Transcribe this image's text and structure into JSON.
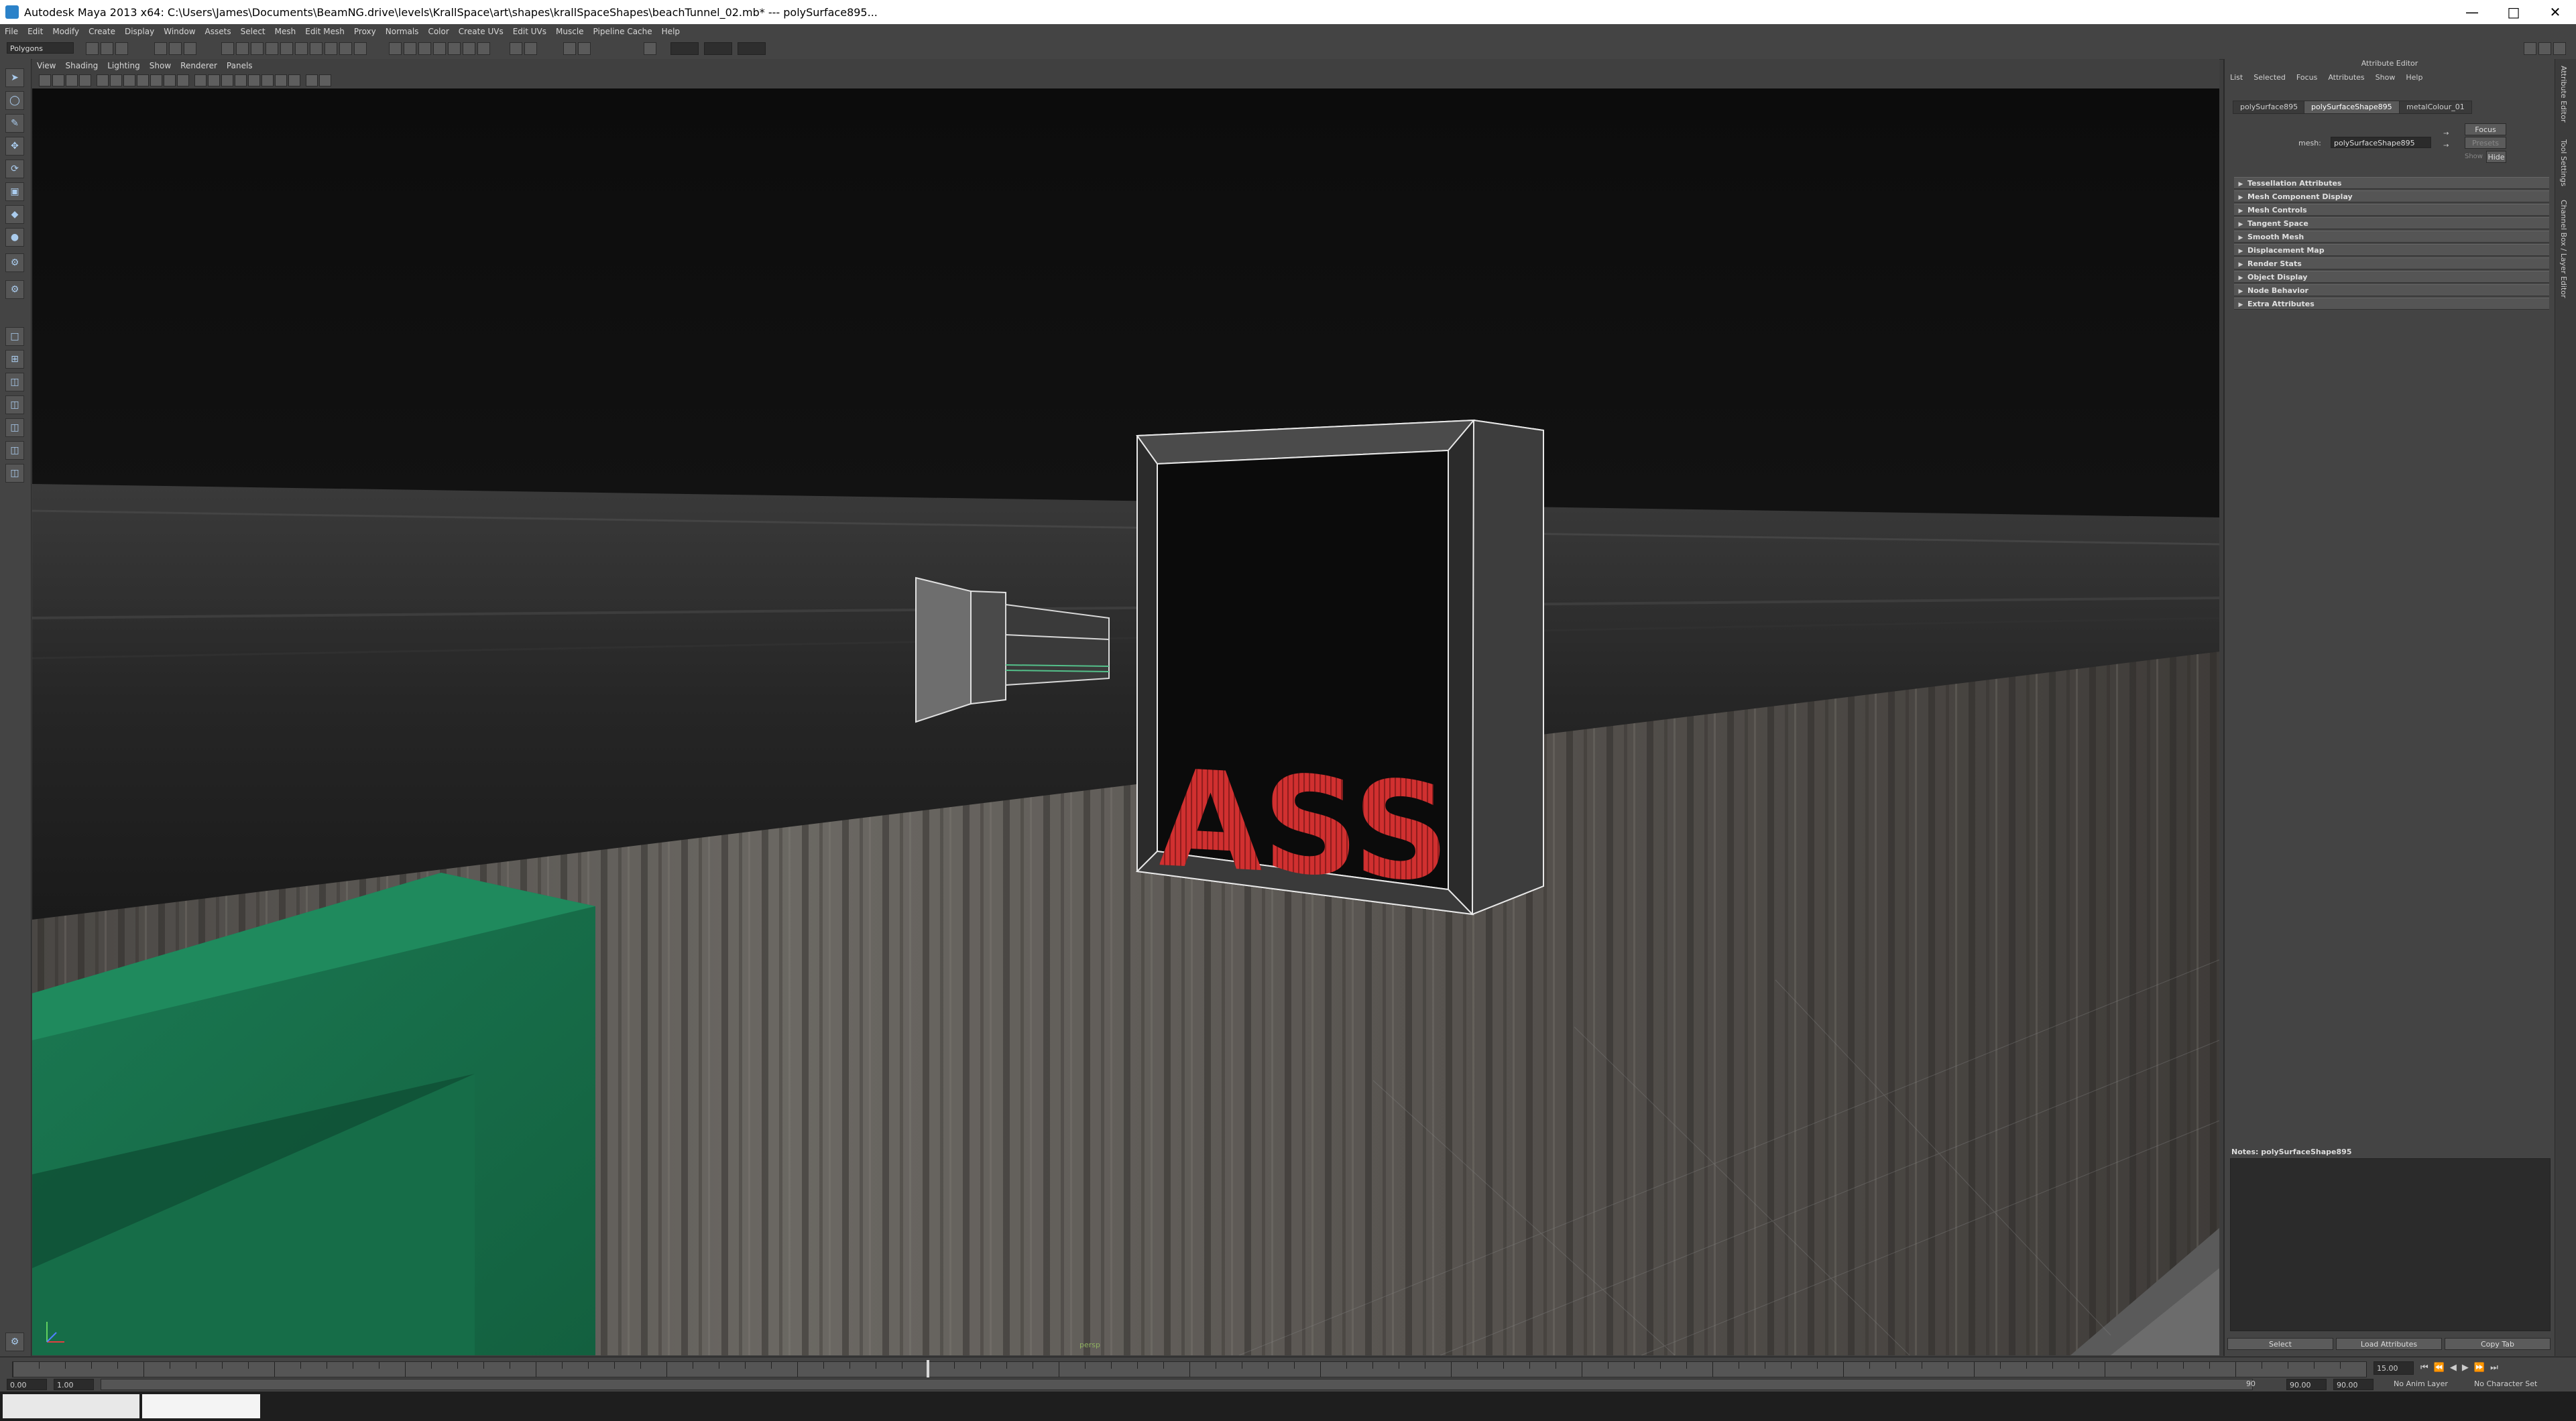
{
  "window": {
    "title": "Autodesk Maya 2013 x64: C:\\Users\\James\\Documents\\BeamNG.drive\\levels\\KrallSpace\\art\\shapes\\krallSpaceShapes\\beachTunnel_02.mb*   ---   polySurface895..."
  },
  "menu": [
    "File",
    "Edit",
    "Modify",
    "Create",
    "Display",
    "Window",
    "Assets",
    "Select",
    "Mesh",
    "Edit Mesh",
    "Proxy",
    "Normals",
    "Color",
    "Create UVs",
    "Edit UVs",
    "Muscle",
    "Pipeline Cache",
    "Help"
  ],
  "status_line": {
    "mode": "Polygons"
  },
  "viewport": {
    "menu": [
      "View",
      "Shading",
      "Lighting",
      "Show",
      "Renderer",
      "Panels"
    ],
    "camera_label": "persp",
    "sign_text": "ASS"
  },
  "attribute_editor": {
    "title": "Attribute Editor",
    "menu": [
      "List",
      "Selected",
      "Focus",
      "Attributes",
      "Show",
      "Help"
    ],
    "tabs": [
      "polySurface895",
      "polySurfaceShape895",
      "metalColour_01"
    ],
    "active_tab": 1,
    "mesh_label": "mesh:",
    "mesh_value": "polySurfaceShape895",
    "focus_button": "Focus",
    "presets_button": "Presets",
    "show_label": "Show",
    "hide_button": "Hide",
    "sections": [
      "Tessellation Attributes",
      "Mesh Component Display",
      "Mesh Controls",
      "Tangent Space",
      "Smooth Mesh",
      "Displacement Map",
      "Render Stats",
      "Object Display",
      "Node Behavior",
      "Extra Attributes"
    ],
    "notes_label": "Notes:  polySurfaceShape895",
    "bottom_buttons": [
      "Select",
      "Load Attributes",
      "Copy Tab"
    ]
  },
  "side_strip": [
    "Attribute Editor",
    "Tool Settings",
    "Channel Box / Layer Editor"
  ],
  "time_slider": {
    "start": "0.00",
    "end": "1.00",
    "current": "15.00",
    "range_end": "90",
    "playback_end": "90.00",
    "end_time": "90.00",
    "anim_layer": "No Anim Layer",
    "char_set": "No Character Set"
  }
}
